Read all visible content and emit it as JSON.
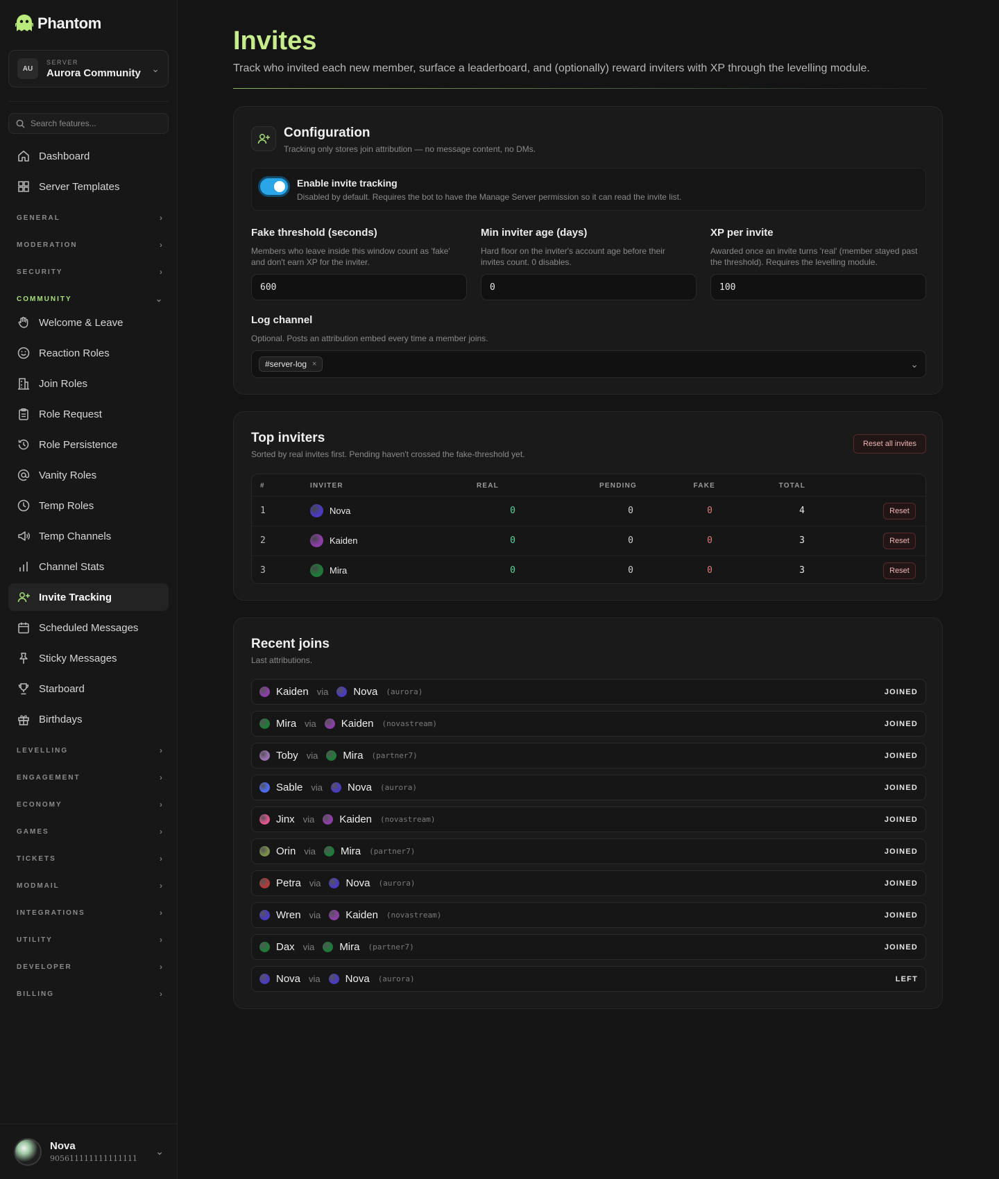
{
  "app": {
    "name": "Phantom"
  },
  "server": {
    "caption": "SERVER",
    "initials": "AU",
    "name": "Aurora Community"
  },
  "search": {
    "placeholder": "Search features..."
  },
  "nav_top": [
    {
      "label": "Dashboard",
      "icon": "home-icon"
    },
    {
      "label": "Server Templates",
      "icon": "grid-icon"
    }
  ],
  "sections_collapsed_top": [
    "GENERAL",
    "MODERATION",
    "SECURITY"
  ],
  "section_open": "COMMUNITY",
  "community_items": [
    {
      "label": "Welcome & Leave",
      "icon": "hand-icon"
    },
    {
      "label": "Reaction Roles",
      "icon": "smile-icon"
    },
    {
      "label": "Join Roles",
      "icon": "building-icon"
    },
    {
      "label": "Role Request",
      "icon": "clipboard-icon"
    },
    {
      "label": "Role Persistence",
      "icon": "history-icon"
    },
    {
      "label": "Vanity Roles",
      "icon": "at-icon"
    },
    {
      "label": "Temp Roles",
      "icon": "clock-icon"
    },
    {
      "label": "Temp Channels",
      "icon": "megaphone-icon"
    },
    {
      "label": "Channel Stats",
      "icon": "bar-chart-icon"
    },
    {
      "label": "Invite Tracking",
      "icon": "user-plus-icon",
      "active": true
    },
    {
      "label": "Scheduled Messages",
      "icon": "calendar-icon"
    },
    {
      "label": "Sticky Messages",
      "icon": "pin-icon"
    },
    {
      "label": "Starboard",
      "icon": "trophy-icon"
    },
    {
      "label": "Birthdays",
      "icon": "gift-icon"
    }
  ],
  "sections_collapsed_bottom": [
    "LEVELLING",
    "ENGAGEMENT",
    "ECONOMY",
    "GAMES",
    "TICKETS",
    "MODMAIL",
    "INTEGRATIONS",
    "UTILITY",
    "DEVELOPER",
    "BILLING"
  ],
  "user": {
    "name": "Nova",
    "id": "905611111111111111"
  },
  "page": {
    "title": "Invites",
    "subtitle": "Track who invited each new member, surface a leaderboard, and (optionally) reward inviters with XP through the levelling module."
  },
  "config": {
    "title": "Configuration",
    "subtitle": "Tracking only stores join attribution — no message content, no DMs.",
    "toggle": {
      "label": "Enable invite tracking",
      "help": "Disabled by default. Requires the bot to have the Manage Server permission so it can read the invite list.",
      "enabled": true
    },
    "fields": [
      {
        "label": "Fake threshold (seconds)",
        "help": "Members who leave inside this window count as 'fake' and don't earn XP for the inviter.",
        "value": "600"
      },
      {
        "label": "Min inviter age (days)",
        "help": "Hard floor on the inviter's account age before their invites count. 0 disables.",
        "value": "0"
      },
      {
        "label": "XP per invite",
        "help": "Awarded once an invite turns 'real' (member stayed past the threshold). Requires the levelling module.",
        "value": "100"
      }
    ],
    "log_channel": {
      "label": "Log channel",
      "help": "Optional. Posts an attribution embed every time a member joins.",
      "selected": "#server-log",
      "remove_glyph": "×"
    }
  },
  "top_inviters": {
    "title": "Top inviters",
    "subtitle": "Sorted by real invites first. Pending haven't crossed the fake-threshold yet.",
    "reset_all_label": "Reset all invites",
    "columns": [
      "#",
      "INVITER",
      "REAL",
      "PENDING",
      "FAKE",
      "TOTAL"
    ],
    "rows": [
      {
        "rank": "1",
        "name": "Nova",
        "real": "0",
        "pending": "0",
        "fake": "0",
        "total": "4",
        "reset": "Reset",
        "color": "#4a3bbf"
      },
      {
        "rank": "2",
        "name": "Kaiden",
        "real": "0",
        "pending": "0",
        "fake": "0",
        "total": "3",
        "reset": "Reset",
        "color": "#8b3fa6"
      },
      {
        "rank": "3",
        "name": "Mira",
        "real": "0",
        "pending": "0",
        "fake": "0",
        "total": "3",
        "reset": "Reset",
        "color": "#1f7a3a"
      }
    ]
  },
  "recent_joins": {
    "title": "Recent joins",
    "subtitle": "Last attributions.",
    "via_label": "via",
    "rows": [
      {
        "member": "Kaiden",
        "member_color": "#8b3fa6",
        "inviter": "Nova",
        "inviter_color": "#4a3bbf",
        "code": "(aurora)",
        "status": "JOINED"
      },
      {
        "member": "Mira",
        "member_color": "#1f7a3a",
        "inviter": "Kaiden",
        "inviter_color": "#8b3fa6",
        "code": "(novastream)",
        "status": "JOINED"
      },
      {
        "member": "Toby",
        "member_color": "#9a6fb0",
        "inviter": "Mira",
        "inviter_color": "#1f7a3a",
        "code": "(partner7)",
        "status": "JOINED"
      },
      {
        "member": "Sable",
        "member_color": "#4d6bf0",
        "inviter": "Nova",
        "inviter_color": "#4a3bbf",
        "code": "(aurora)",
        "status": "JOINED"
      },
      {
        "member": "Jinx",
        "member_color": "#e0558f",
        "inviter": "Kaiden",
        "inviter_color": "#8b3fa6",
        "code": "(novastream)",
        "status": "JOINED"
      },
      {
        "member": "Orin",
        "member_color": "#7a8f4a",
        "inviter": "Mira",
        "inviter_color": "#1f7a3a",
        "code": "(partner7)",
        "status": "JOINED"
      },
      {
        "member": "Petra",
        "member_color": "#b03a3a",
        "inviter": "Nova",
        "inviter_color": "#4a3bbf",
        "code": "(aurora)",
        "status": "JOINED"
      },
      {
        "member": "Wren",
        "member_color": "#4a3bbf",
        "inviter": "Kaiden",
        "inviter_color": "#8b3fa6",
        "code": "(novastream)",
        "status": "JOINED"
      },
      {
        "member": "Dax",
        "member_color": "#1f7a3a",
        "inviter": "Mira",
        "inviter_color": "#1f7a3a",
        "code": "(partner7)",
        "status": "JOINED"
      },
      {
        "member": "Nova",
        "member_color": "#4a3bbf",
        "inviter": "Nova",
        "inviter_color": "#4a3bbf",
        "code": "(aurora)",
        "status": "LEFT"
      }
    ]
  },
  "colors": {
    "accent": "#c7ec8e",
    "toggle": "#2aa6e8",
    "real": "#5fd39a",
    "fake": "#e07a7a"
  }
}
